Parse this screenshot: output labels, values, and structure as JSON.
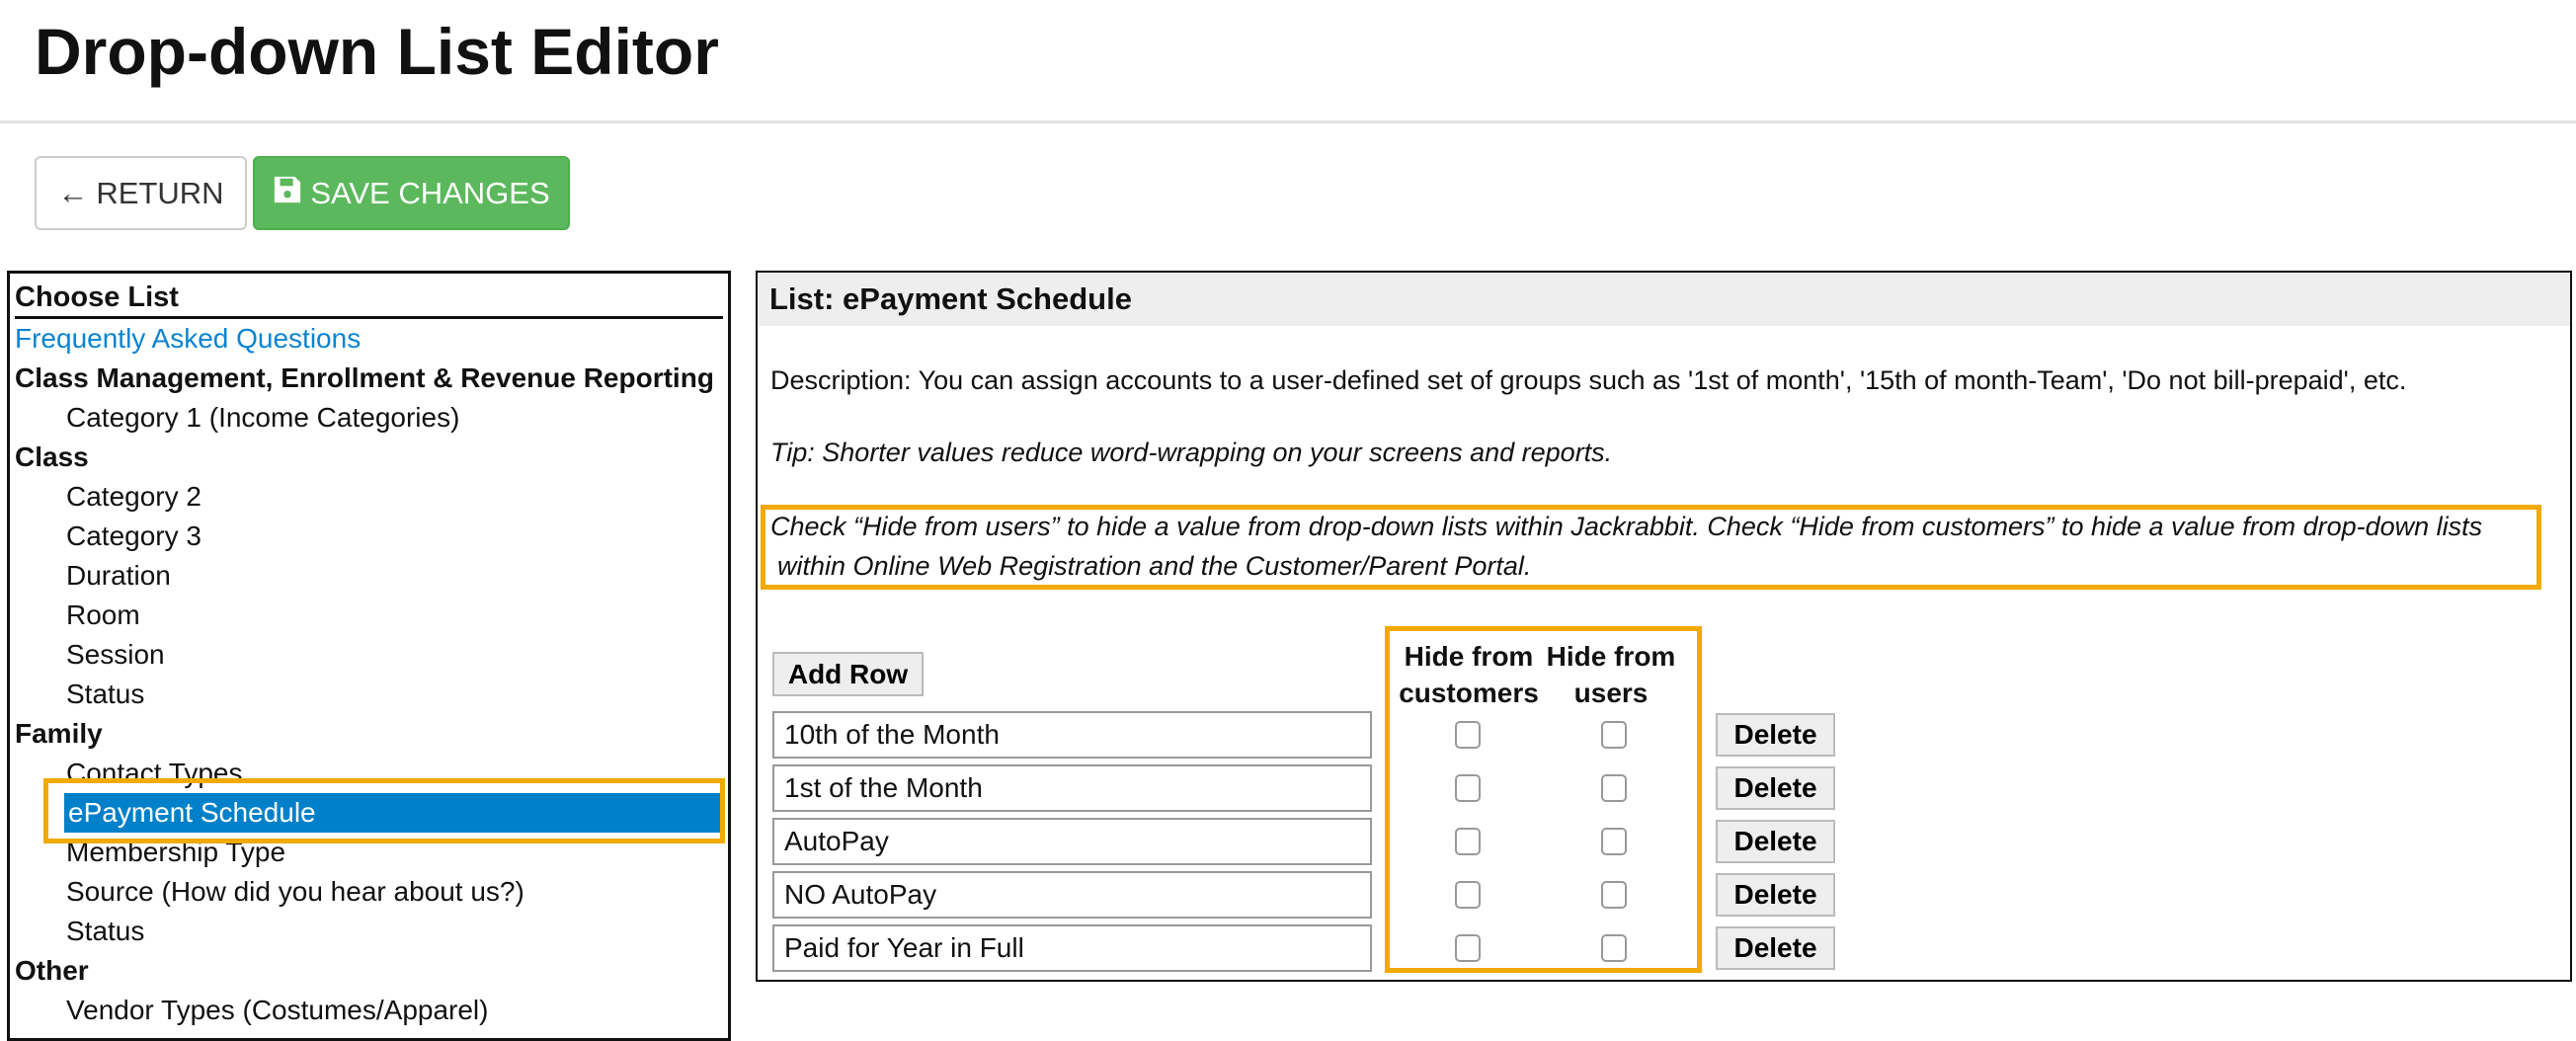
{
  "header": {
    "title": "Drop-down List Editor"
  },
  "toolbar": {
    "return_label": "RETURN",
    "save_label": "SAVE CHANGES"
  },
  "sidebar": {
    "title": "Choose List",
    "items": [
      {
        "label": "Frequently Asked Questions",
        "type": "link"
      },
      {
        "label": "Class Management, Enrollment & Revenue Reporting",
        "type": "grp"
      },
      {
        "label": "Category 1 (Income Categories)",
        "type": "sub"
      },
      {
        "label": "Class",
        "type": "grp"
      },
      {
        "label": "Category 2",
        "type": "sub"
      },
      {
        "label": "Category 3",
        "type": "sub"
      },
      {
        "label": "Duration",
        "type": "sub"
      },
      {
        "label": "Room",
        "type": "sub"
      },
      {
        "label": "Session",
        "type": "sub"
      },
      {
        "label": "Status",
        "type": "sub"
      },
      {
        "label": "Family",
        "type": "grp"
      },
      {
        "label": "Contact Types",
        "type": "sub"
      },
      {
        "label": "ePayment Schedule",
        "type": "sel"
      },
      {
        "label": "Membership Type",
        "type": "sub"
      },
      {
        "label": "Source (How did you hear about us?)",
        "type": "sub"
      },
      {
        "label": "Status",
        "type": "sub"
      },
      {
        "label": "Other",
        "type": "grp"
      },
      {
        "label": "Vendor Types (Costumes/Apparel)",
        "type": "sub"
      }
    ]
  },
  "main": {
    "list_title": "List: ePayment Schedule",
    "description": "Description: You can assign accounts to a user-defined set of groups such as '1st of month', '15th of month-Team', 'Do not bill-prepaid', etc.",
    "tip": "Tip: Shorter values reduce word-wrapping on your screens and reports.",
    "note_line1": "Check “Hide from users” to hide a value from drop-down lists within Jackrabbit. Check “Hide from customers” to hide a value from drop-down lists",
    "note_line2": "within Online Web Registration and the Customer/Parent Portal.",
    "add_row_label": "Add Row",
    "col_customers": "Hide from customers",
    "col_users": "Hide from users",
    "delete_label": "Delete",
    "rows": [
      {
        "value": "10th of the Month",
        "hide_customers": false,
        "hide_users": false
      },
      {
        "value": "1st of the Month",
        "hide_customers": false,
        "hide_users": false
      },
      {
        "value": "AutoPay",
        "hide_customers": false,
        "hide_users": false
      },
      {
        "value": "NO AutoPay",
        "hide_customers": false,
        "hide_users": false
      },
      {
        "value": "Paid for Year in Full",
        "hide_customers": false,
        "hide_users": false
      }
    ]
  },
  "colors": {
    "accent": "#0080c8",
    "save": "#5cb85c",
    "highlight": "#f0aa00"
  }
}
